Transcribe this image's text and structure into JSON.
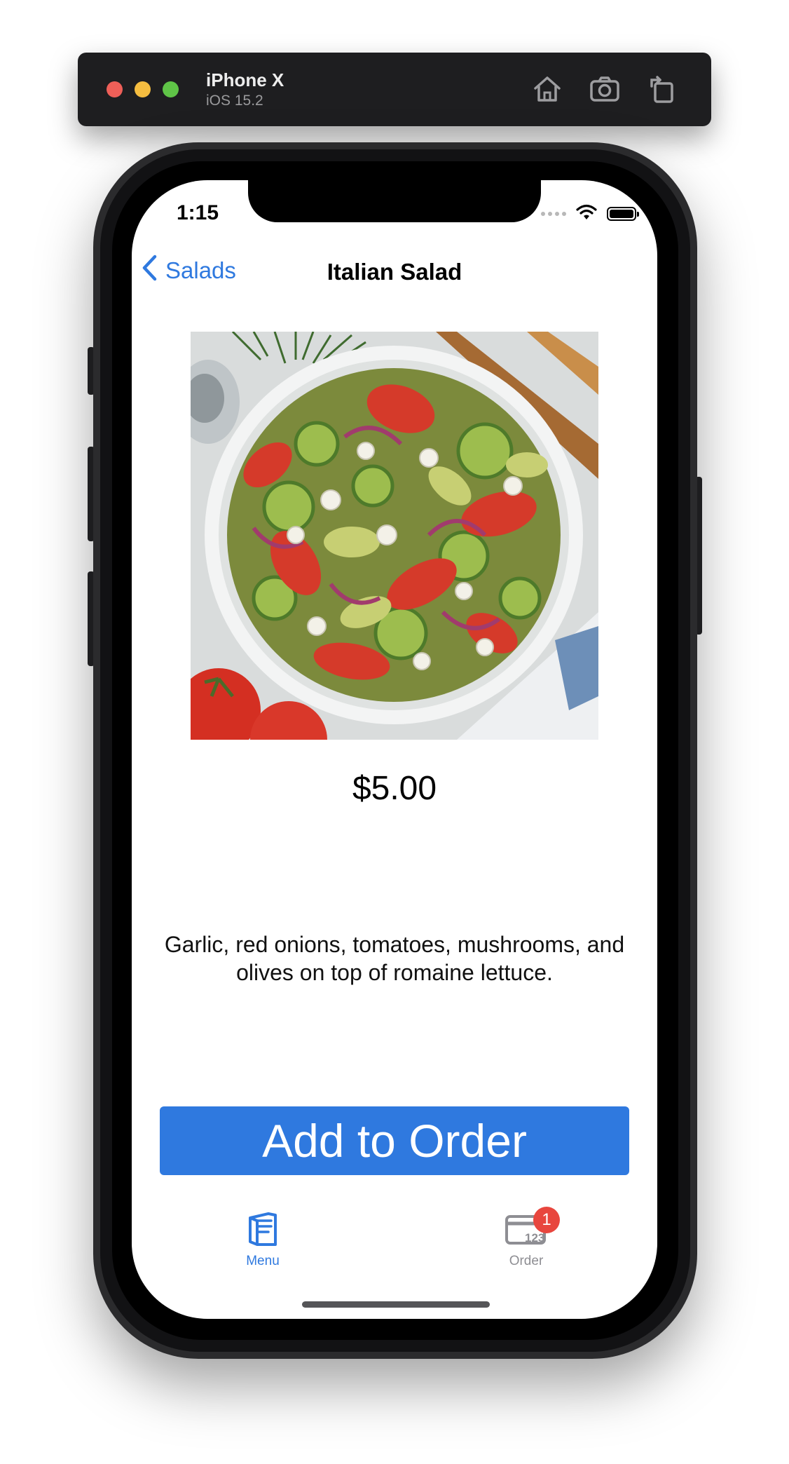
{
  "simulator": {
    "device_name": "iPhone X",
    "os_version": "iOS 15.2",
    "tools": [
      {
        "icon": "home-icon"
      },
      {
        "icon": "camera-icon"
      },
      {
        "icon": "rotate-icon"
      }
    ]
  },
  "status_bar": {
    "time": "1:15",
    "icons": [
      "cellular-dots-icon",
      "wifi-icon",
      "battery-icon"
    ]
  },
  "nav": {
    "back_label": "Salads",
    "title": "Italian Salad"
  },
  "item": {
    "image_description_icon": "salad-photo",
    "price": "$5.00",
    "description": "Garlic, red onions, tomatoes, mushrooms, and olives on top of romaine lettuce.",
    "add_button_label": "Add to Order"
  },
  "tab_bar": {
    "tabs": [
      {
        "label": "Menu",
        "icon": "menu-book-icon",
        "selected": true
      },
      {
        "label": "Order",
        "icon": "order-card-icon",
        "selected": false,
        "badge": "1"
      }
    ]
  },
  "colors": {
    "accent": "#2f79df",
    "badge": "#e8463e",
    "inactive_tab": "#8e8e93"
  }
}
